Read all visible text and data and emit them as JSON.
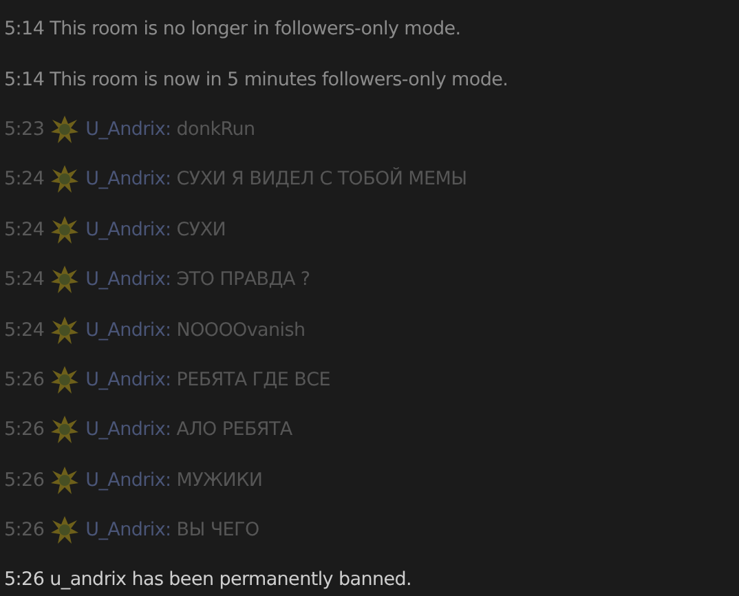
{
  "messages": [
    {
      "kind": "system",
      "dimmed": true,
      "time": "5:14",
      "text": "This room is no longer in followers-only mode."
    },
    {
      "kind": "system",
      "dimmed": true,
      "time": "5:14",
      "text": "This room is now in 5 minutes followers-only mode."
    },
    {
      "kind": "chat",
      "deleted": true,
      "time": "5:23",
      "user": "U_Andrix:",
      "text": "donkRun"
    },
    {
      "kind": "chat",
      "deleted": true,
      "time": "5:24",
      "user": "U_Andrix:",
      "text": "СУХИ Я ВИДЕЛ С ТОБОЙ МЕМЫ"
    },
    {
      "kind": "chat",
      "deleted": true,
      "time": "5:24",
      "user": "U_Andrix:",
      "text": "СУХИ"
    },
    {
      "kind": "chat",
      "deleted": true,
      "time": "5:24",
      "user": "U_Andrix:",
      "text": "ЭТО ПРАВДА ?"
    },
    {
      "kind": "chat",
      "deleted": true,
      "time": "5:24",
      "user": "U_Andrix:",
      "text": "NOOOOvanish"
    },
    {
      "kind": "chat",
      "deleted": true,
      "time": "5:26",
      "user": "U_Andrix:",
      "text": "РЕБЯТА ГДЕ ВСЕ"
    },
    {
      "kind": "chat",
      "deleted": true,
      "time": "5:26",
      "user": "U_Andrix:",
      "text": "АЛО РЕБЯТА"
    },
    {
      "kind": "chat",
      "deleted": true,
      "time": "5:26",
      "user": "U_Andrix:",
      "text": "МУЖИКИ"
    },
    {
      "kind": "chat",
      "deleted": true,
      "time": "5:26",
      "user": "U_Andrix:",
      "text": "ВЫ ЧЕГО"
    },
    {
      "kind": "system",
      "dimmed": false,
      "time": "5:26",
      "text": "u_andrix has been permanently banned."
    }
  ]
}
